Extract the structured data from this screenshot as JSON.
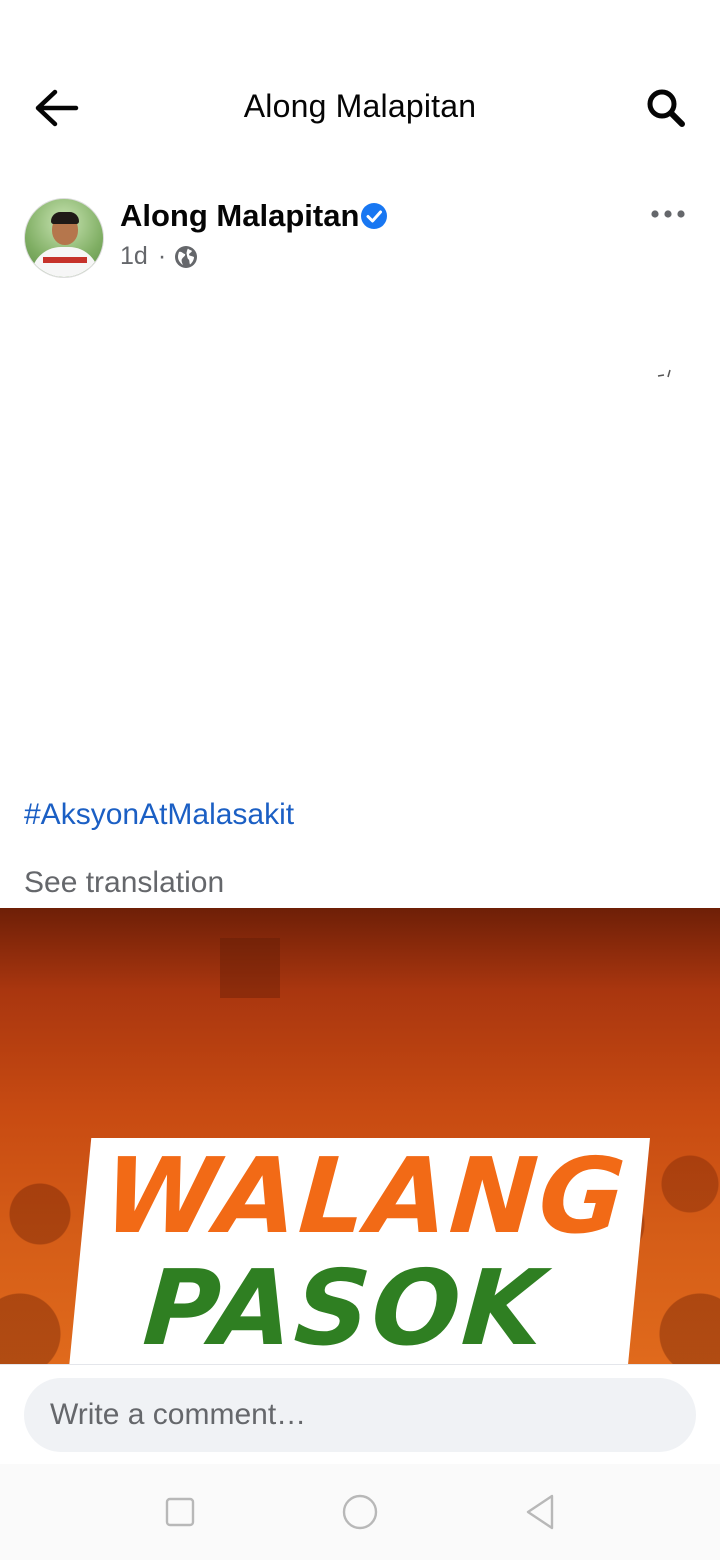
{
  "header": {
    "title": "Along Malapitan",
    "back_icon": "arrow-left-icon",
    "search_icon": "search-icon"
  },
  "post": {
    "author": "Along Malapitan",
    "verified": true,
    "time": "1d",
    "separator": "·",
    "privacy_icon": "globe-icon",
    "hashtag": "#AksyonAtMalasakit",
    "see_translation": "See translation",
    "image_text": {
      "line1": "WALANG",
      "line2": "PASOK"
    }
  },
  "comment": {
    "placeholder": "Write a comment…"
  },
  "system_nav": {
    "items": [
      "recents-square-icon",
      "home-circle-icon",
      "back-triangle-icon"
    ]
  },
  "colors": {
    "link": "#1b5fc4",
    "verified": "#1877f2",
    "secondary_text": "#65676b",
    "image_orange": "#f26a16",
    "image_green": "#2f7f22"
  }
}
